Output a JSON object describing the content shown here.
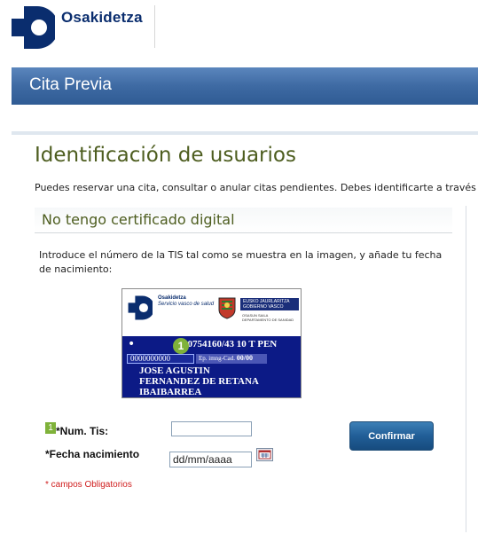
{
  "header": {
    "brand_name": "Osakidetza",
    "banner_title": "Cita Previa"
  },
  "main": {
    "page_title": "Identificación de usuarios",
    "intro": "Puedes reservar una cita, consultar o anular citas pendientes. Debes identificarte a través d"
  },
  "panel": {
    "title": "No tengo certificado digital",
    "instructions": "Introduce el número de la TIS tal como se muestra en la imagen, y añade tu fecha de nacimiento:"
  },
  "card_image": {
    "issuer": "Osakidetza",
    "issuer_sub": "Servicio vasco de salud",
    "government_line1": "EUSKO JAURLARITZA",
    "government_line2": "GOBIERNO VASCO",
    "department_line1": "OSASUN SAILA",
    "department_line2": "DEPARTAMENTO DE SANIDAD",
    "marker": "1",
    "code_line": "00754160/43 10 T PEN",
    "tis_number": "0000000000",
    "ep_label": "Ep. imng-Cad.",
    "ep_value": "00/00",
    "name_line1": "JOSE AGUSTIN",
    "name_line2": "FERNANDEZ DE RETANA",
    "name_line3": "IBAIBARREA"
  },
  "form": {
    "step_badge": "1",
    "tis_label": "*Num. Tis:",
    "tis_value": "",
    "birth_label": "*Fecha nacimiento",
    "birth_value": "dd/mm/aaaa",
    "confirm_label": "Confirmar",
    "required_note": "* campos Obligatorios"
  },
  "colors": {
    "brand": "#0a2d6e",
    "banner": "#3e6aa3",
    "title_green": "#4d5d1f",
    "badge_green": "#7fb23a",
    "button": "#215e97",
    "required_red": "#d02020"
  }
}
